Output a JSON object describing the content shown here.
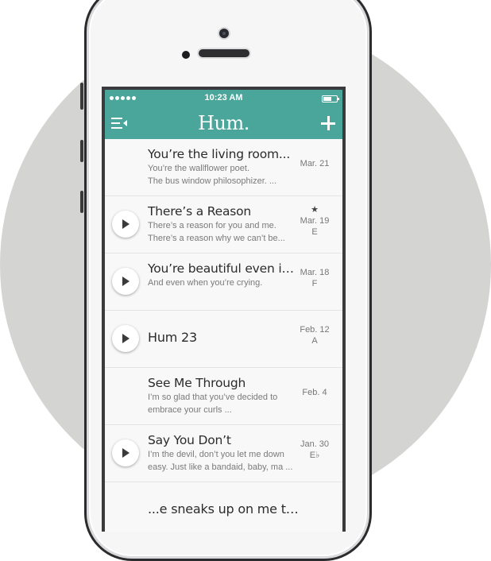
{
  "status_bar": {
    "time": "10:23 AM"
  },
  "navbar": {
    "logo": "Hum."
  },
  "songs": [
    {
      "title": "You’re the living room...",
      "line1": "You’re the wallflower poet.",
      "line2": "The bus window philosophizer. ...",
      "date": "Mar. 21",
      "key": "",
      "star": "",
      "has_play": false
    },
    {
      "title": "There’s a Reason",
      "line1": "There’s a reason for you and me.",
      "line2": "There’s a reason why we can’t be...",
      "date": "Mar. 19",
      "key": "E",
      "star": "★",
      "has_play": true
    },
    {
      "title": "You’re beautiful even in sil...",
      "line1": "And even when you’re crying.",
      "line2": "",
      "date": "Mar. 18",
      "key": "F",
      "star": "",
      "has_play": true
    },
    {
      "title": "Hum 23",
      "line1": "",
      "line2": "",
      "date": "Feb. 12",
      "key": "A",
      "star": "",
      "has_play": true
    },
    {
      "title": "See Me Through",
      "line1": "I’m so glad that you’ve decided to",
      "line2": "embrace your curls ...",
      "date": "Feb. 4",
      "key": "",
      "star": "",
      "has_play": false
    },
    {
      "title": "Say You Don’t",
      "line1": "I’m the devil, don’t you let me down",
      "line2": "easy. Just like a bandaid, baby, ma ...",
      "date": "Jan. 30",
      "key": "E♭",
      "star": "",
      "has_play": true
    },
    {
      "title": "...e sneaks up on me the...",
      "line1": "",
      "line2": "",
      "date": "",
      "key": "",
      "star": "",
      "has_play": false
    }
  ],
  "colors": {
    "accent": "#4aa59a",
    "background_circle": "#d4d4d2"
  },
  "icons": {
    "menu": "menu-icon",
    "add": "plus-icon",
    "play": "play-icon"
  }
}
